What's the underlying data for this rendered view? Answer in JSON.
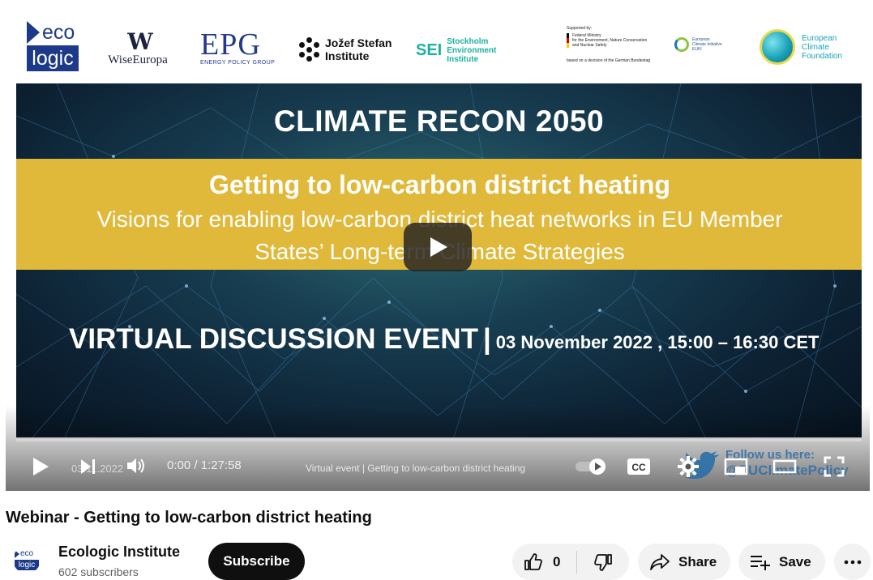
{
  "player": {
    "logos": {
      "ecologic": {
        "top": "eco",
        "bottom": "logic"
      },
      "wiseeuropa": {
        "name": "WiseEuropa"
      },
      "epg": {
        "big": "EPG",
        "small": "ENERGY POLICY GROUP"
      },
      "jsi": {
        "line1": "Jožef Stefan",
        "line2": "Institute"
      },
      "sei": {
        "abbr": "SEI",
        "line1": "Stockholm",
        "line2": "Environment",
        "line3": "Institute"
      },
      "bmu": {
        "supported": "Supported by:",
        "line1": "Federal Ministry",
        "line2": "for the Environment, Nature Conservation",
        "line3": "and Nuclear Safety",
        "footer": "based on a decision of the German Bundestag"
      },
      "euki": {
        "line1": "European",
        "line2": "Climate Initiative",
        "line3": "EUKI"
      },
      "ecf": {
        "line1": "European",
        "line2": "Climate",
        "line3": "Foundation"
      }
    },
    "banner": {
      "title": "CLIMATE RECON 2050",
      "yellow_title": "Getting to low-carbon district heating",
      "yellow_sub_1": "Visions for enabling low-carbon district heat networks in EU Member",
      "yellow_sub_2": "States’ Long-term Climate Strategies",
      "event_label": "VIRTUAL DISCUSSION EVENT",
      "event_separator": "|",
      "event_date": "03 November 2022 , 15:00 – 16:30 CET"
    },
    "controls": {
      "time": "0:00 / 1:27:58",
      "chapter": "Virtual event | Getting to low-carbon district heating",
      "overlay_date": "03.11.2022",
      "progress": 0,
      "follow_line1": "Follow us here:",
      "follow_line2": "@EUClimatePolicy"
    },
    "colors": {
      "yellow_band": "#e0b93b",
      "banner_dark": "#0d2234",
      "player_controls": "#ffffff"
    }
  },
  "video": {
    "title": "Webinar - Getting to low-carbon district heating"
  },
  "channel": {
    "name": "Ecologic Institute",
    "subscribers": "602 subscribers",
    "avatar_top": "eco",
    "avatar_bottom": "logic",
    "subscribe_label": "Subscribe"
  },
  "actions": {
    "like_count": "0",
    "share_label": "Share",
    "save_label": "Save"
  },
  "icons": [
    "play-icon",
    "next-icon",
    "volume-icon",
    "toggle-icon",
    "captions-icon",
    "settings-icon",
    "miniplayer-icon",
    "theater-icon",
    "fullscreen-icon",
    "thumbs-up-icon",
    "thumbs-down-icon",
    "share-icon",
    "save-playlist-icon",
    "more-icon"
  ]
}
